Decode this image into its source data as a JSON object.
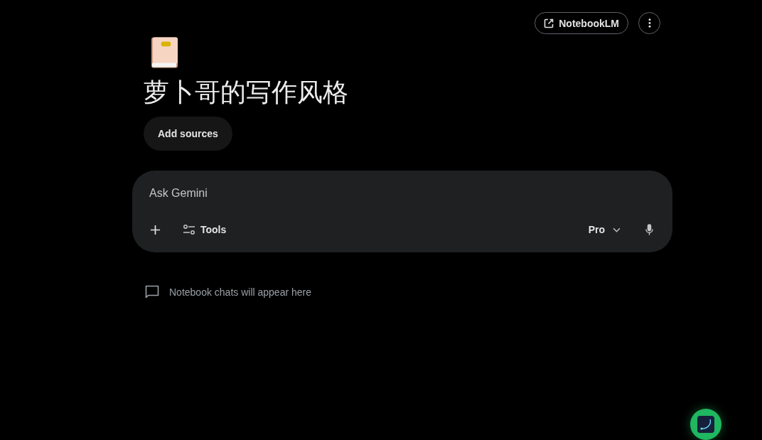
{
  "header": {
    "notebooklm_button": {
      "label": "NotebookLM"
    }
  },
  "notebook": {
    "title": "萝卜哥的写作风格",
    "add_sources_button": {
      "label": "Add sources"
    }
  },
  "prompt": {
    "placeholder": "Ask Gemini",
    "tools_button": {
      "label": "Tools"
    },
    "model_picker": {
      "label": "Pro"
    }
  },
  "empty_state": {
    "message": "Notebook chats will appear here"
  }
}
